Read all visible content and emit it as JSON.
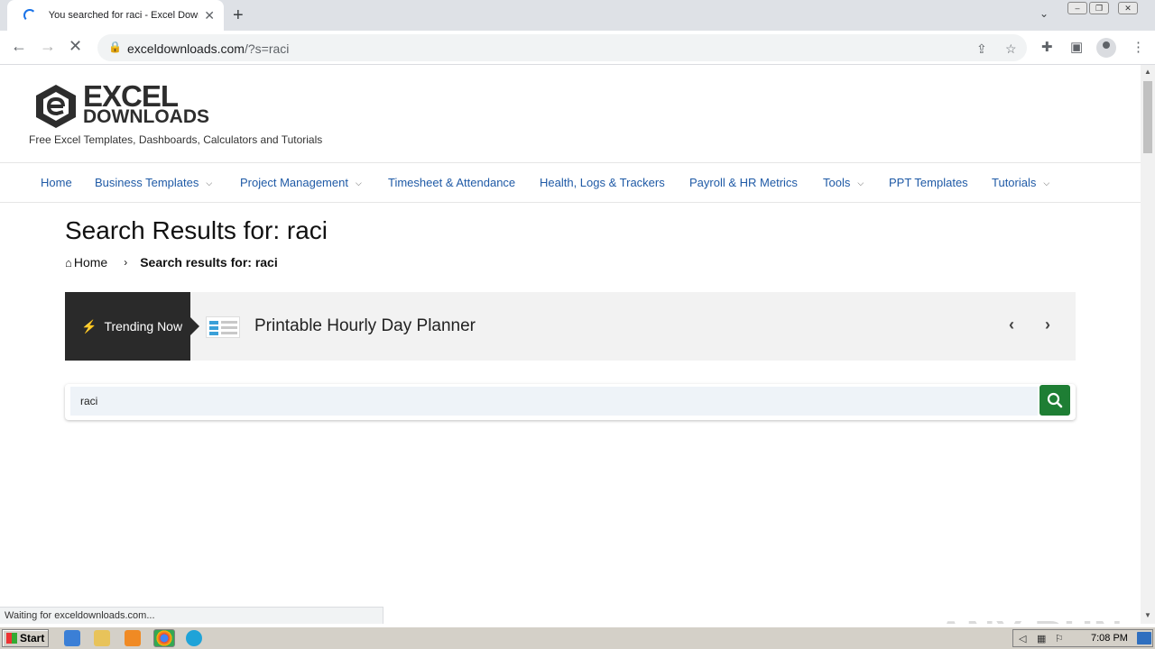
{
  "browser": {
    "tab_title": "You searched for raci - Excel Downlo",
    "url_host": "exceldownloads.com",
    "url_path": "/?s=raci",
    "status_text": "Waiting for exceldownloads.com..."
  },
  "site": {
    "logo_word1": "EXCEL",
    "logo_word2": "DOWNLOADS",
    "tagline": "Free Excel Templates, Dashboards, Calculators and Tutorials",
    "nav": [
      {
        "label": "Home",
        "dropdown": false
      },
      {
        "label": "Business Templates",
        "dropdown": true
      },
      {
        "label": "Project Management",
        "dropdown": true
      },
      {
        "label": "Timesheet & Attendance",
        "dropdown": false
      },
      {
        "label": "Health, Logs & Trackers",
        "dropdown": false
      },
      {
        "label": "Payroll & HR Metrics",
        "dropdown": false
      },
      {
        "label": "Tools",
        "dropdown": true
      },
      {
        "label": "PPT Templates",
        "dropdown": false
      },
      {
        "label": "Tutorials",
        "dropdown": true
      }
    ]
  },
  "main": {
    "heading": "Search Results for: raci",
    "breadcrumb_home": "Home",
    "breadcrumb_current": "Search results for: raci",
    "trending_label": "Trending Now",
    "trending_title": "Printable Hourly Day Planner",
    "search_value": "raci"
  },
  "watermark": "ANY RUN",
  "taskbar": {
    "start_label": "Start",
    "clock": "7:08 PM"
  },
  "colors": {
    "nav_link": "#1f5aa6",
    "search_button": "#1e7e34",
    "trending_label_bg": "#2a2a2a"
  }
}
